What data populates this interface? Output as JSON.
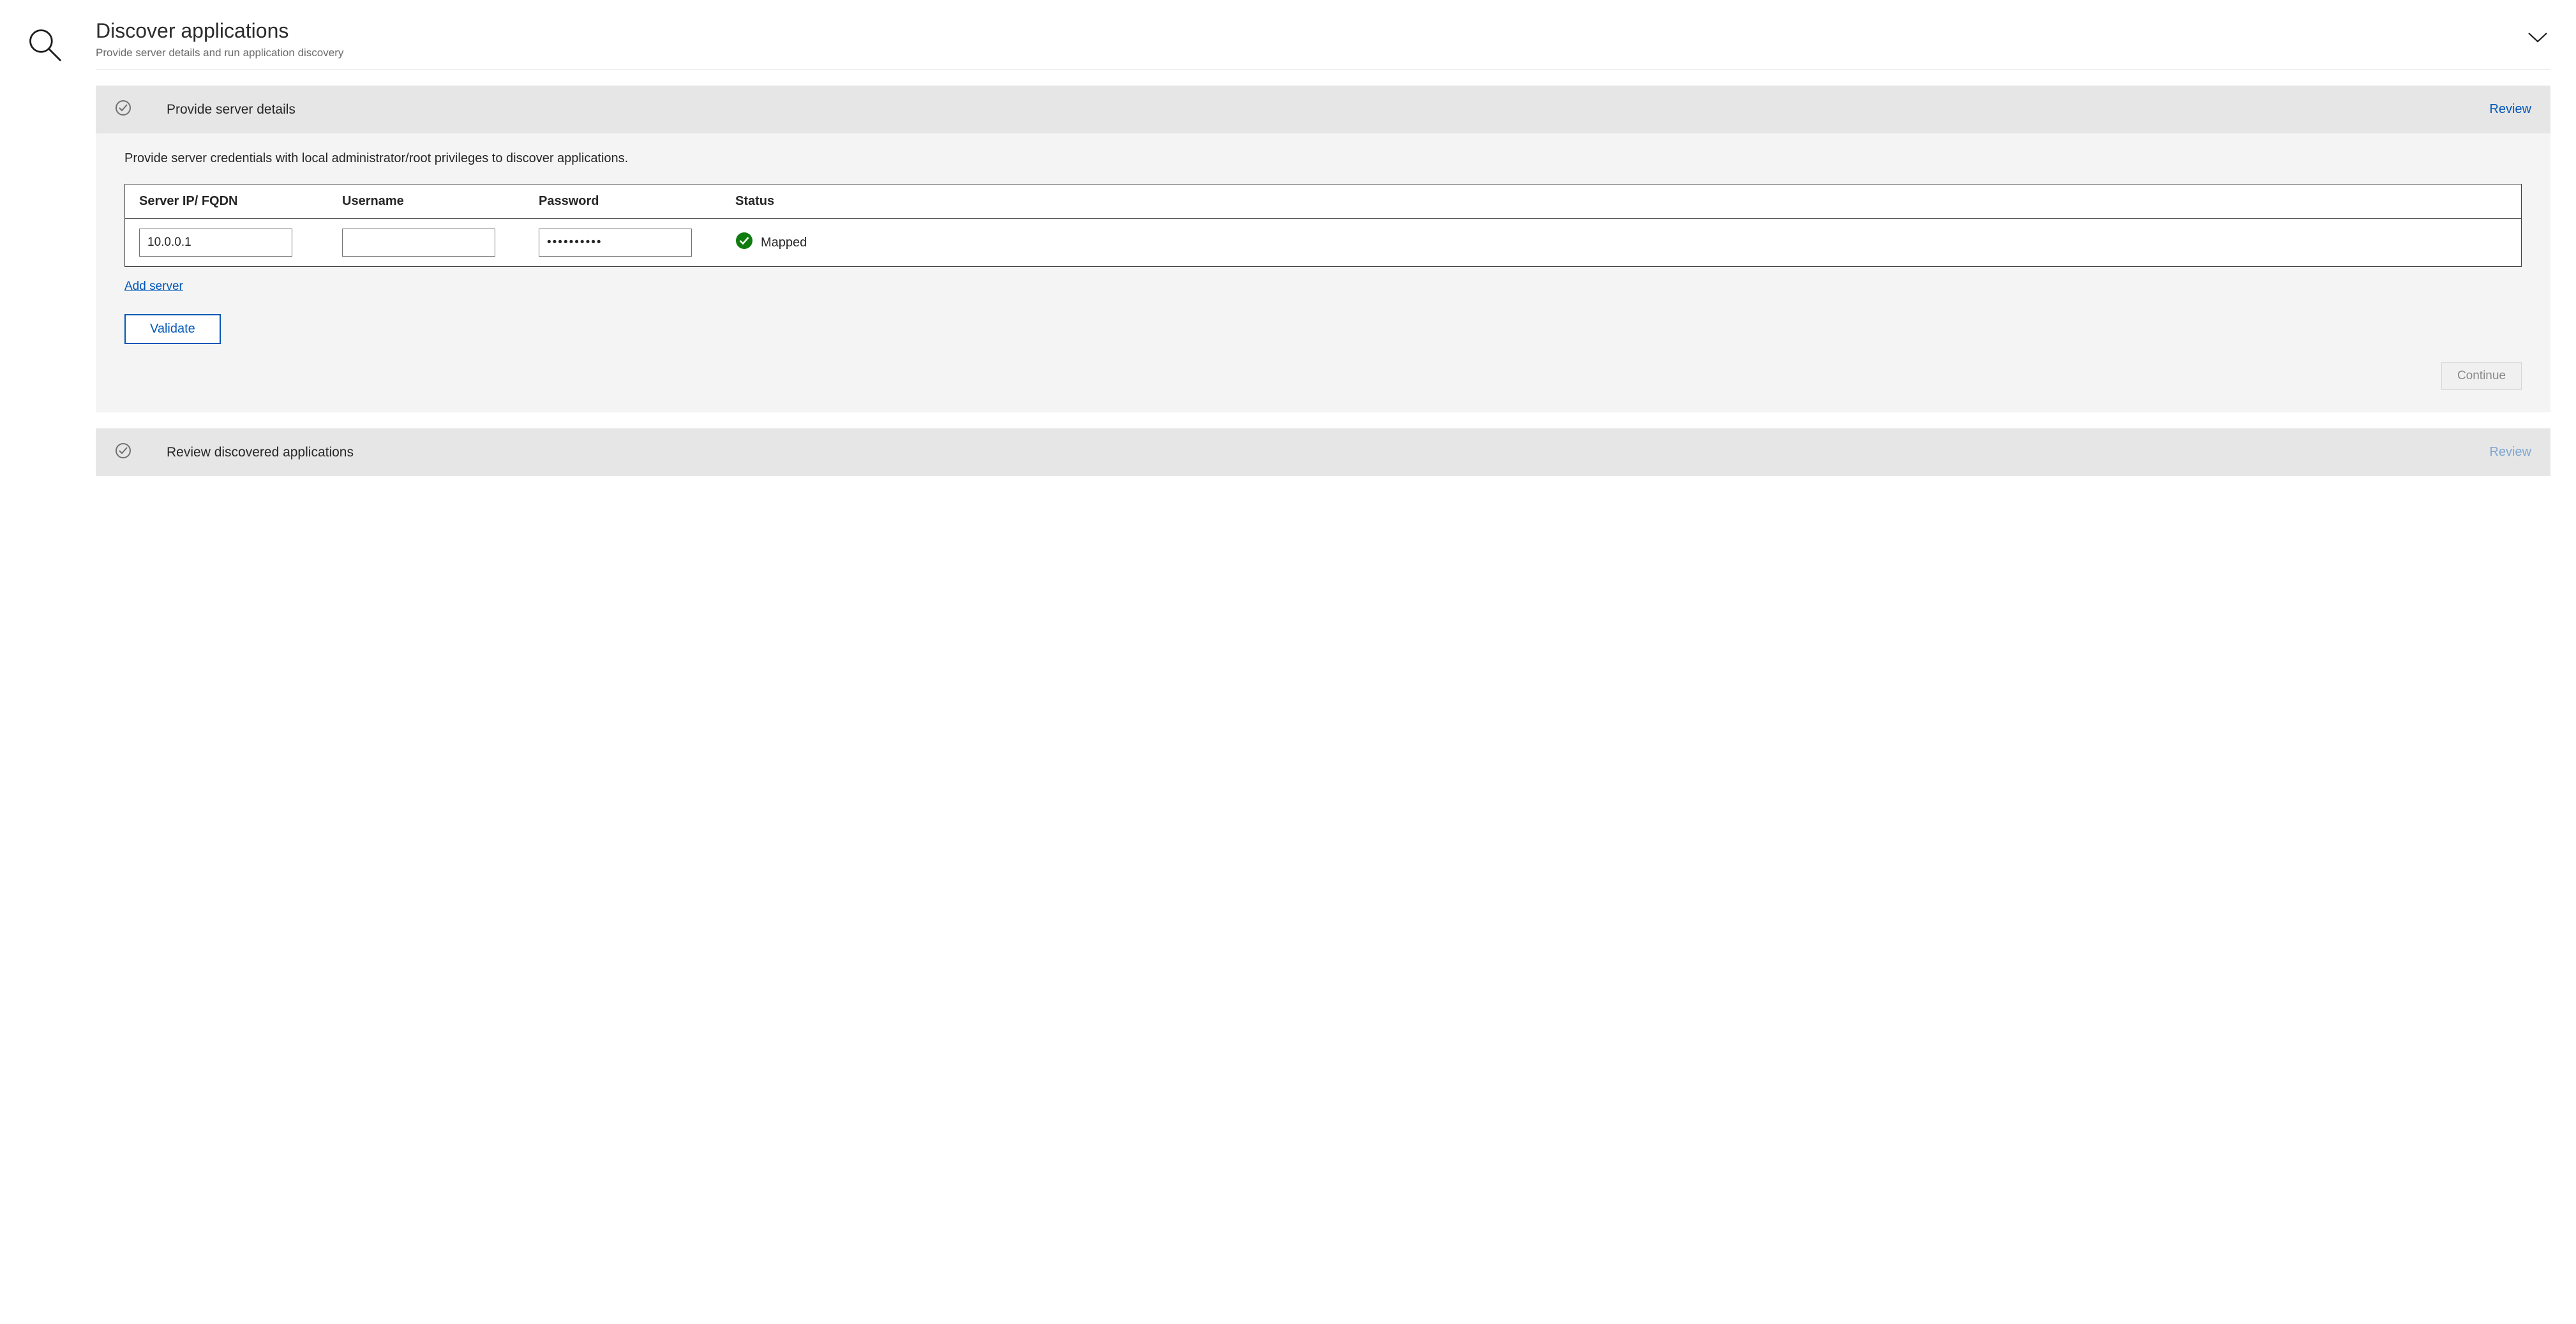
{
  "header": {
    "title": "Discover applications",
    "subtitle": "Provide server details and run application discovery"
  },
  "section1": {
    "title": "Provide server details",
    "review_label": "Review",
    "description": "Provide server credentials with local administrator/root privileges to discover applications.",
    "table": {
      "headers": {
        "ip": "Server IP/ FQDN",
        "username": "Username",
        "password": "Password",
        "status": "Status"
      },
      "row": {
        "ip_value": "10.0.0.1",
        "username_value": "",
        "password_value": "••••••••••",
        "status_value": "Mapped"
      }
    },
    "add_server_label": "Add server",
    "validate_label": "Validate",
    "continue_label": "Continue"
  },
  "section2": {
    "title": "Review discovered applications",
    "review_label": "Review"
  }
}
